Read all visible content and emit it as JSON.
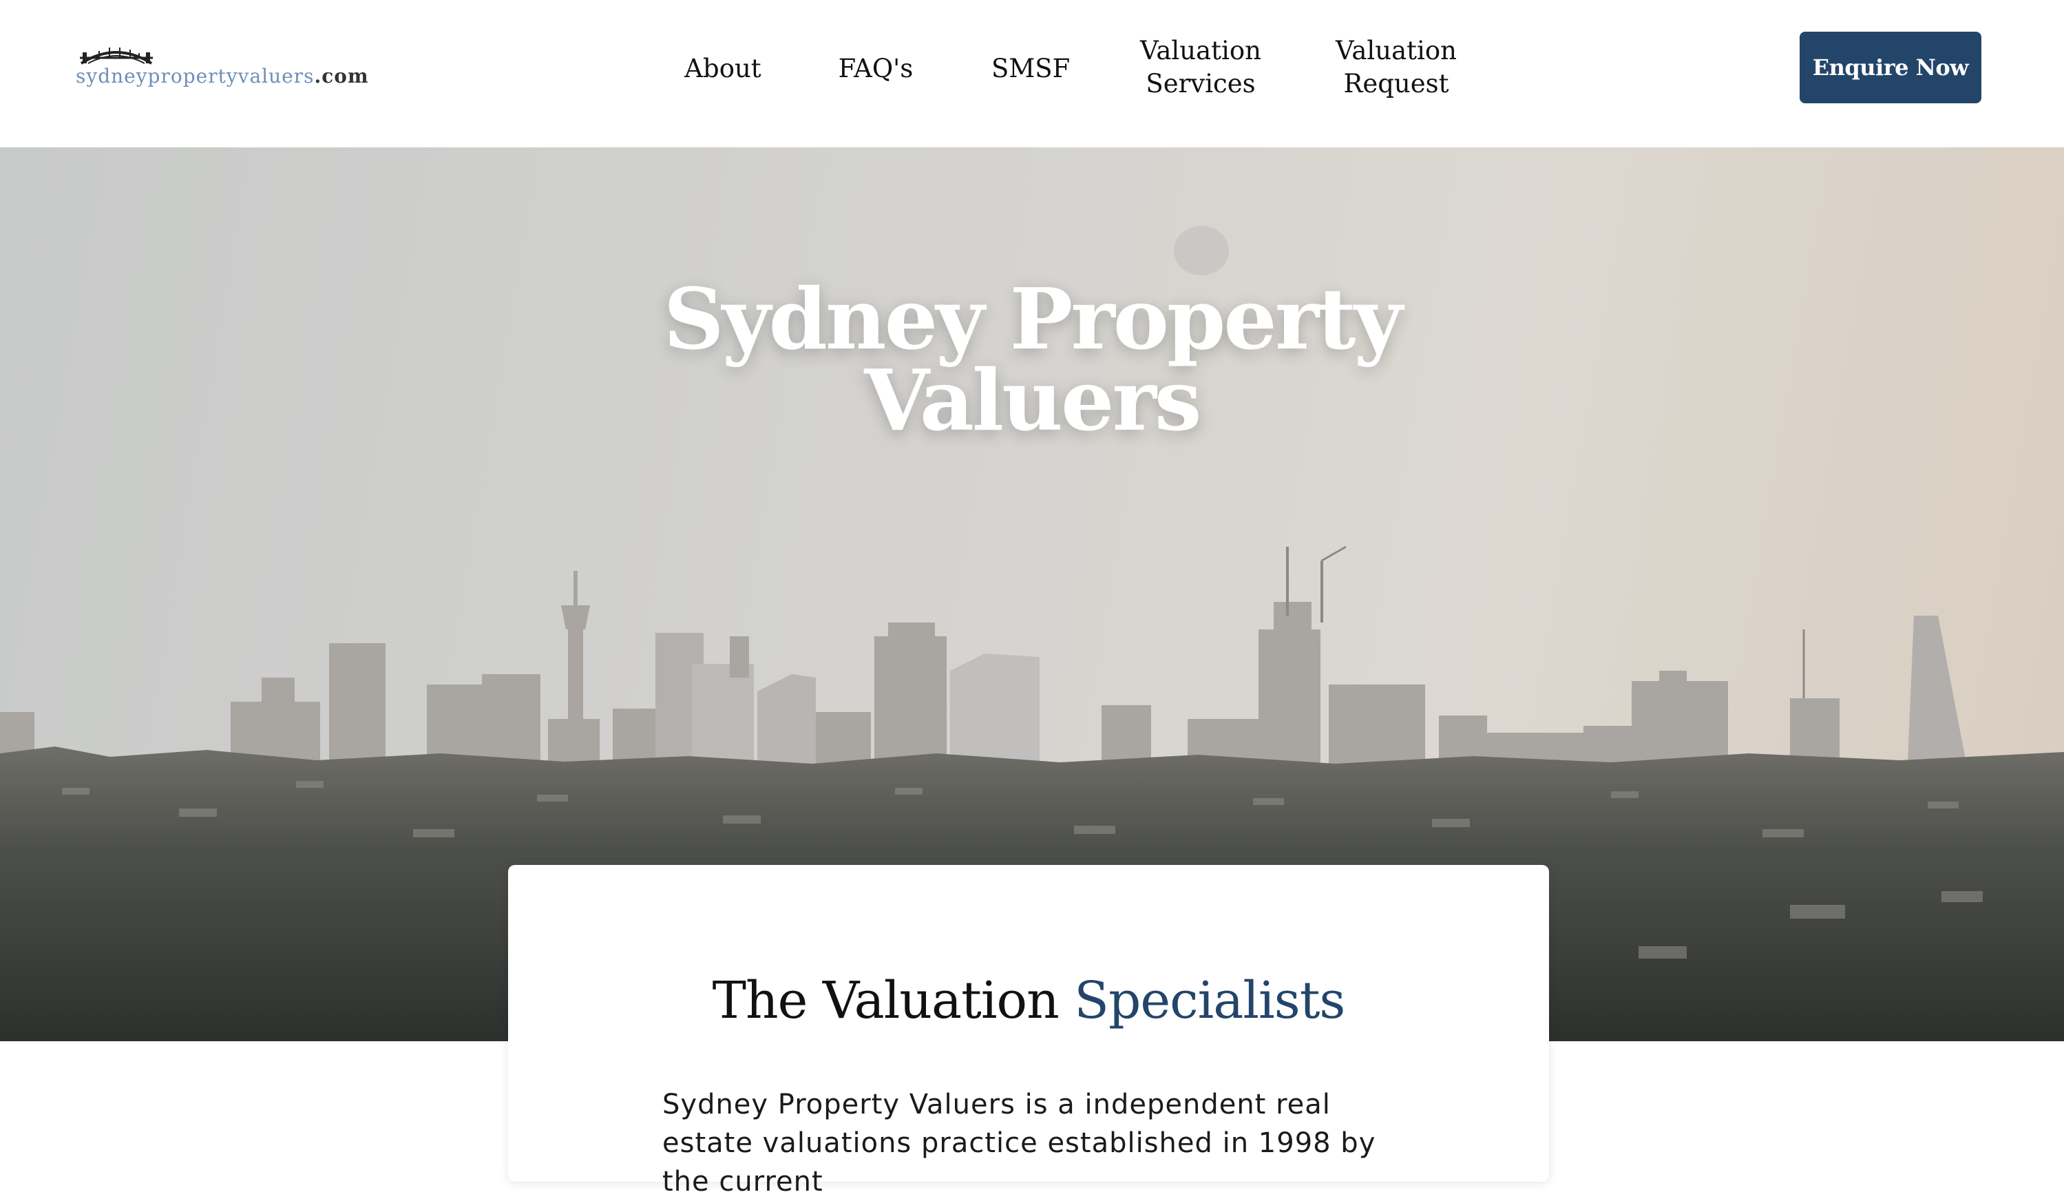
{
  "header": {
    "logo_text_main": "sydneypropertyvaluers",
    "logo_text_tld": ".com",
    "nav": [
      {
        "label": "About"
      },
      {
        "label": "FAQ's"
      },
      {
        "label": "SMSF"
      },
      {
        "label": "Valuation Services"
      },
      {
        "label": "Valuation Request"
      }
    ],
    "cta_label": "Enquire Now"
  },
  "hero": {
    "title_line1": "Sydney Property",
    "title_line2": "Valuers"
  },
  "intro": {
    "heading_part1": "The Valuation",
    "heading_part2": "Specialists",
    "body": "Sydney Property Valuers is a independent real estate valuations practice established in 1998 by the current"
  },
  "colors": {
    "brand_navy": "#234569",
    "logo_blue": "#6c8fb9"
  },
  "icons": {
    "logo": "harbour-bridge-icon"
  }
}
